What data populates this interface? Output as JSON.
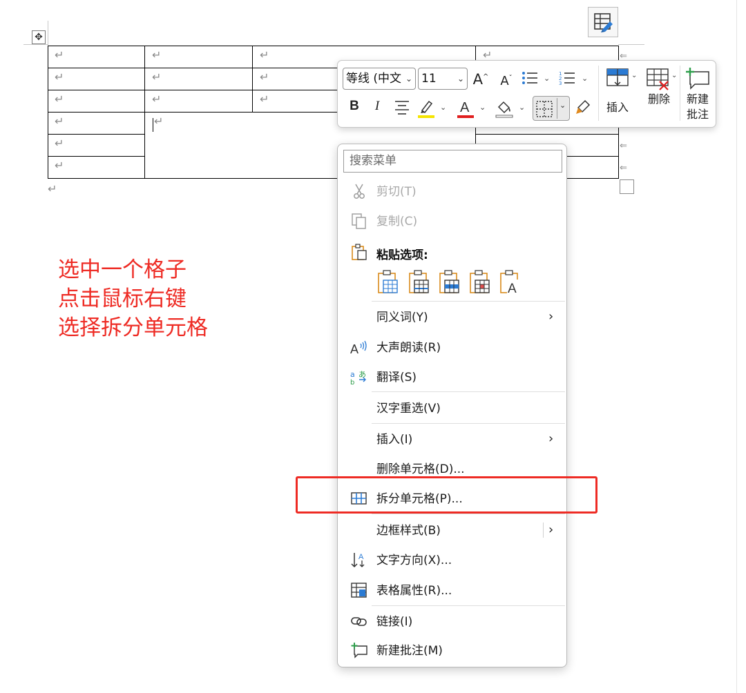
{
  "table": {
    "return_mark": "↵",
    "cursor_mark": "⇐"
  },
  "annotation": {
    "lines": [
      "选中一个格子",
      "点击鼠标右键",
      "选择拆分单元格"
    ],
    "color": "#ee2b24"
  },
  "mini_toolbar": {
    "font_name": "等线 (中文",
    "font_size": "11",
    "grow_font": "A",
    "shrink_font": "A",
    "bold": "B",
    "italic": "I",
    "insert_label": "插入",
    "delete_label": "删除",
    "new_comment_line1": "新建",
    "new_comment_line2": "批注",
    "highlight_color": "#f5e400",
    "font_color": "#e01e1e"
  },
  "context_menu": {
    "search_placeholder": "搜索菜单",
    "cut": "剪切(T)",
    "copy": "复制(C)",
    "paste_options": "粘贴选项:",
    "synonyms": "同义词(Y)",
    "read_aloud": "大声朗读(R)",
    "translate": "翻译(S)",
    "reconversion": "汉字重选(V)",
    "insert": "插入(I)",
    "delete_cells": "删除单元格(D)...",
    "split_cells": "拆分单元格(P)...",
    "border_styles": "边框样式(B)",
    "text_direction": "文字方向(X)...",
    "table_properties": "表格属性(R)...",
    "link": "链接(I)",
    "new_comment": "新建批注(M)"
  },
  "colors": {
    "accent_blue": "#2b7bd4",
    "paste_orange": "#d98a1b",
    "green": "#2e9e4b",
    "highlight_red": "#ee2b24"
  }
}
